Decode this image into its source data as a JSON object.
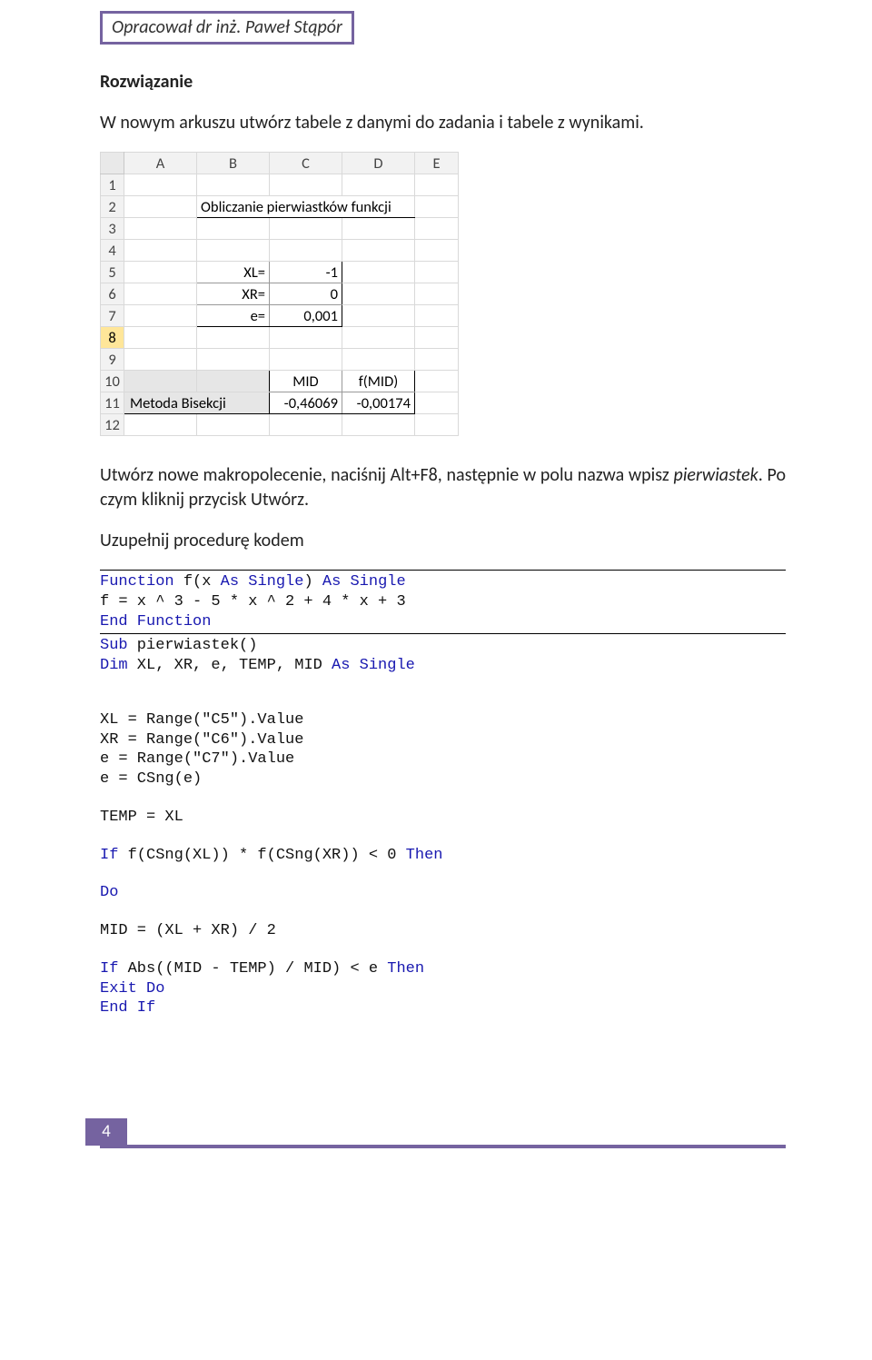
{
  "header": {
    "author_line": "Opracował dr inż. Paweł Stąpór"
  },
  "text": {
    "heading": "Rozwiązanie",
    "p1": "W nowym arkuszu utwórz tabele z danymi do zadania i tabele z wynikami.",
    "p2a": "Utwórz nowe makropolecenie, naciśnij Alt+F8, następnie w polu nazwa wpisz ",
    "p2_it": "pierwiastek",
    "p2b": ". Po czym kliknij przycisk Utwórz.",
    "p3": "Uzupełnij procedurę kodem"
  },
  "sheet": {
    "cols": [
      "A",
      "B",
      "C",
      "D",
      "E"
    ],
    "rows": [
      "1",
      "2",
      "3",
      "4",
      "5",
      "6",
      "7",
      "8",
      "9",
      "10",
      "11",
      "12"
    ],
    "selected_row": "8",
    "title": "Obliczanie pierwiastków funkcji",
    "xl_lbl": "XL=",
    "xl_val": "-1",
    "xr_lbl": "XR=",
    "xr_val": "0",
    "e_lbl": "e=",
    "e_val": "0,001",
    "method": "Metoda Bisekcji",
    "mid_hdr": "MID",
    "fmid_hdr": "f(MID)",
    "mid_val": "-0,46069",
    "fmid_val": "-0,00174"
  },
  "code": {
    "l01a": "Function",
    "l01b": " f(x ",
    "l01c": "As Single",
    "l01d": ") ",
    "l01e": "As Single",
    "l02": "f = x ^ 3 - 5 * x ^ 2 + 4 * x + 3",
    "l03": "End Function",
    "l04a": "Sub",
    "l04b": " pierwiastek()",
    "l05a": "Dim",
    "l05b": " XL, XR, e, TEMP, MID ",
    "l05c": "As Single",
    "l06": "XL = Range(\"C5\").Value",
    "l07": "XR = Range(\"C6\").Value",
    "l08": "e = Range(\"C7\").Value",
    "l09": "e = CSng(e)",
    "l10": "TEMP = XL",
    "l11a": "If",
    "l11b": " f(CSng(XL)) * f(CSng(XR)) < 0 ",
    "l11c": "Then",
    "l12": "Do",
    "l13": "MID = (XL + XR) / 2",
    "l14a": "If",
    "l14b": " Abs((MID - TEMP) / MID) < e ",
    "l14c": "Then",
    "l15": "Exit Do",
    "l16": "End If"
  },
  "footer": {
    "page": "4"
  }
}
